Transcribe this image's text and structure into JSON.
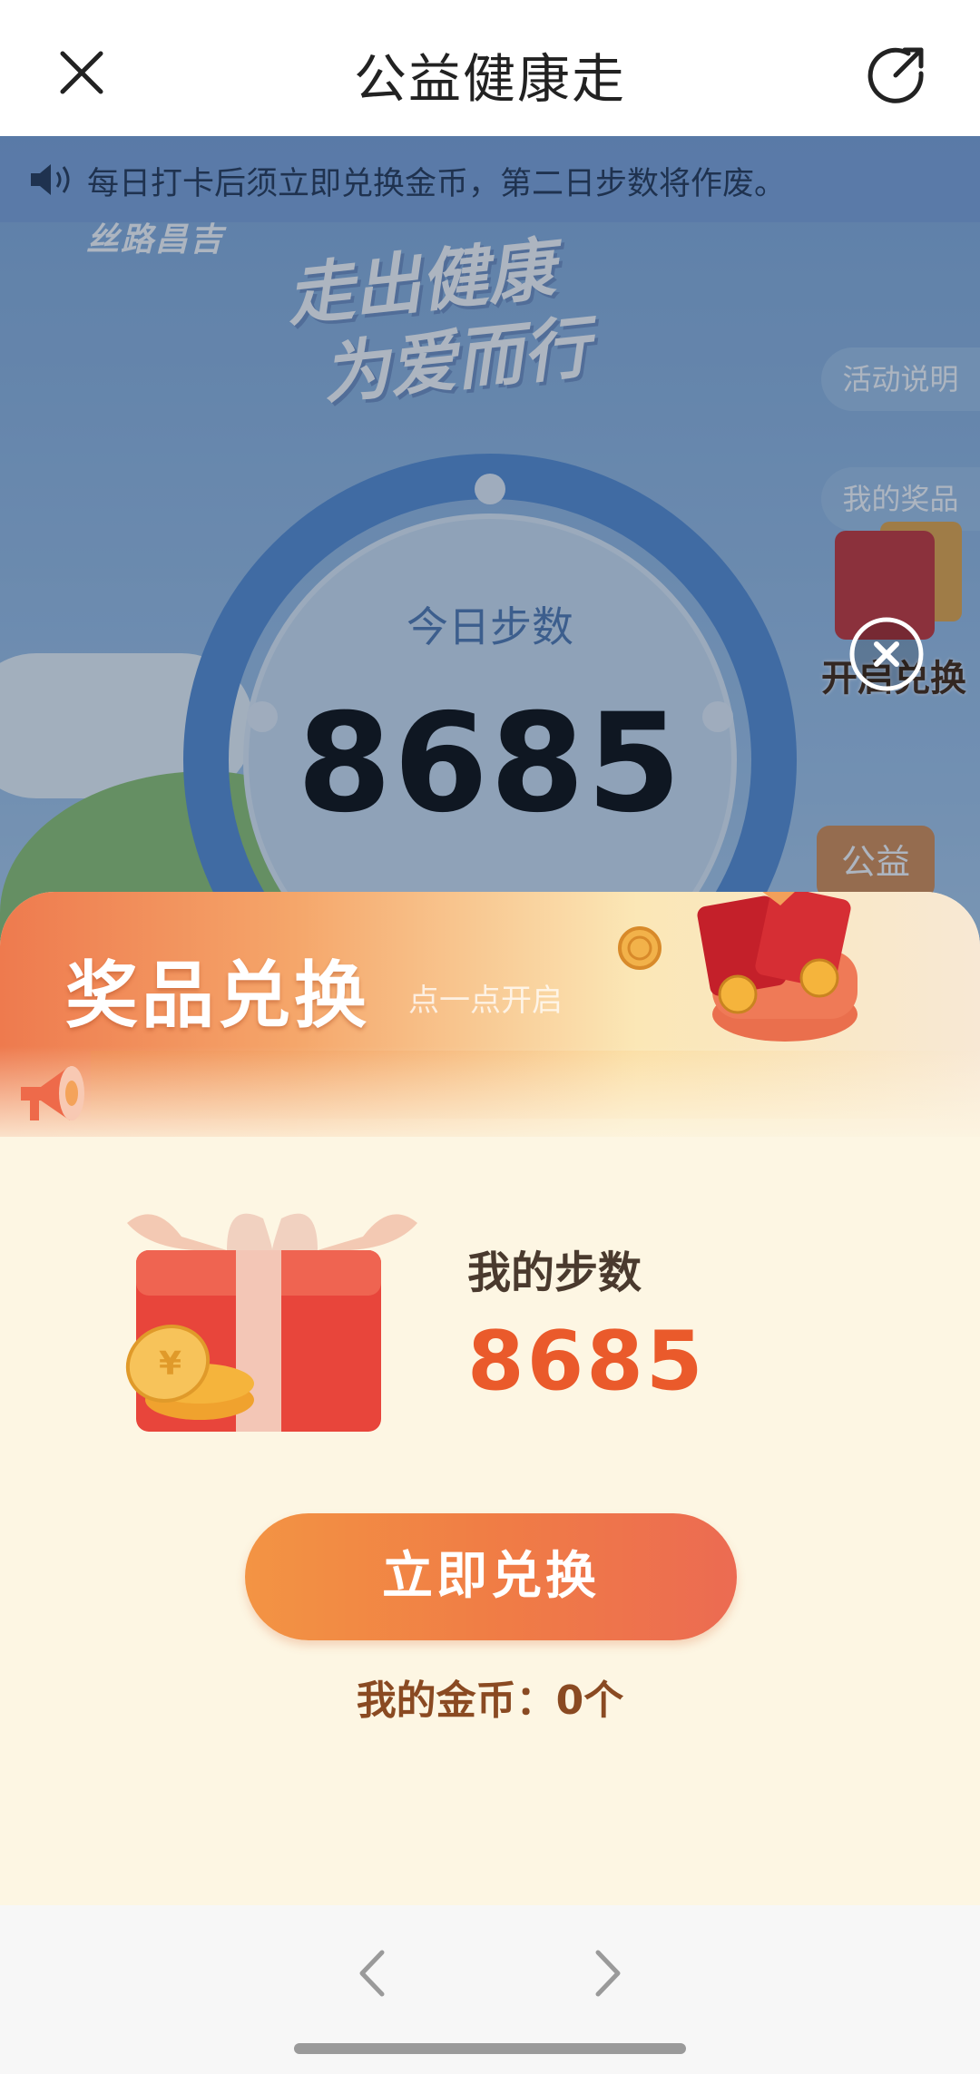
{
  "navbar": {
    "title": "公益健康走",
    "close_icon": "close-icon",
    "share_icon": "share-icon"
  },
  "background": {
    "notice": "每日打卡后须立即兑换金币，第二日步数将作废。",
    "logo": "丝路昌吉",
    "slogan_line1": "走出健康",
    "slogan_line2": "为爱而行",
    "rules_button": "活动说明",
    "prizes_button": "我的奖品",
    "open_exchange": "开启兑换",
    "today_label": "今日步数",
    "today_steps": "8685",
    "public_tag": "公益"
  },
  "sheet": {
    "title": "奖品兑换",
    "subtitle": "点一点开启",
    "my_steps_label": "我的步数",
    "my_steps_value": "8685",
    "exchange_button": "立即兑换",
    "coins_text": "我的金币：0个"
  },
  "colors": {
    "accent": "#ea5a2b",
    "button_start": "#f39444",
    "button_end": "#ec6b52",
    "sheet_bg": "#fdf6e3"
  }
}
